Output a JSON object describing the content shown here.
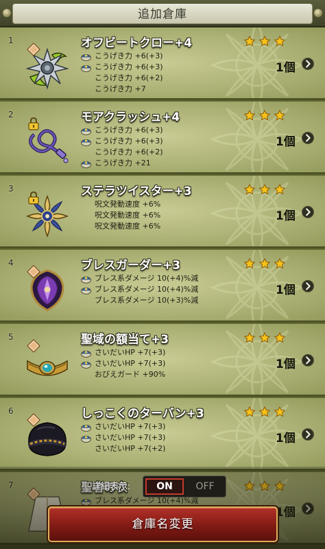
{
  "title": "追加倉庫",
  "items": [
    {
      "index": "1",
      "name": "オフビートクロー+4",
      "rarity_stars": 3,
      "quantity": "1個",
      "icon": "spiked-claw-icon",
      "locked": false,
      "stats": [
        {
          "text": "こうげき力 +6(+3)",
          "stat_icon": true
        },
        {
          "text": "こうげき力 +6(+3)",
          "stat_icon": true
        },
        {
          "text": "こうげき力 +6(+2)",
          "stat_icon": false
        },
        {
          "text": "こうげき力 +7",
          "stat_icon": false
        }
      ]
    },
    {
      "index": "2",
      "name": "モアクラッシュ+4",
      "rarity_stars": 3,
      "quantity": "1個",
      "icon": "whip-icon",
      "locked": true,
      "stats": [
        {
          "text": "こうげき力 +6(+3)",
          "stat_icon": true
        },
        {
          "text": "こうげき力 +6(+3)",
          "stat_icon": true
        },
        {
          "text": "こうげき力 +6(+2)",
          "stat_icon": false
        },
        {
          "text": "こうげき力 +21",
          "stat_icon": true
        }
      ]
    },
    {
      "index": "3",
      "name": "ステラツイスター+3",
      "rarity_stars": 3,
      "quantity": "1個",
      "icon": "star-boomerang-icon",
      "locked": true,
      "stats": [
        {
          "text": "呪文発動速度 +6%",
          "stat_icon": false
        },
        {
          "text": "呪文発動速度 +6%",
          "stat_icon": false
        },
        {
          "text": "呪文発動速度 +6%",
          "stat_icon": false
        }
      ]
    },
    {
      "index": "4",
      "name": "ブレスガーダー+3",
      "rarity_stars": 3,
      "quantity": "1個",
      "icon": "shield-icon",
      "locked": false,
      "stats": [
        {
          "text": "ブレス系ダメージ 10(+4)%減",
          "stat_icon": true
        },
        {
          "text": "ブレス系ダメージ 10(+4)%減",
          "stat_icon": true
        },
        {
          "text": "ブレス系ダメージ 10(+3)%減",
          "stat_icon": false
        }
      ]
    },
    {
      "index": "5",
      "name": "聖域の額当て+3",
      "rarity_stars": 3,
      "quantity": "1個",
      "icon": "circlet-icon",
      "locked": false,
      "stats": [
        {
          "text": "さいだいHP +7(+3)",
          "stat_icon": true
        },
        {
          "text": "さいだいHP +7(+3)",
          "stat_icon": true
        },
        {
          "text": "おびえガード +90%",
          "stat_icon": false
        }
      ]
    },
    {
      "index": "6",
      "name": "しっこくのターバン+3",
      "rarity_stars": 3,
      "quantity": "1個",
      "icon": "turban-icon",
      "locked": false,
      "stats": [
        {
          "text": "さいだいHP +7(+3)",
          "stat_icon": true
        },
        {
          "text": "さいだいHP +7(+3)",
          "stat_icon": true
        },
        {
          "text": "さいだいHP +7(+2)",
          "stat_icon": false
        }
      ]
    },
    {
      "index": "7",
      "name": "聖者の衣",
      "rarity_stars": 3,
      "quantity": "1個",
      "icon": "robe-icon",
      "locked": false,
      "stats": [
        {
          "text": "ブレス系ダメージ 10(+4)%減",
          "stat_icon": true
        }
      ]
    }
  ],
  "detail_toggle": {
    "label": "詳細表示:",
    "on_label": "ON",
    "off_label": "OFF",
    "value": "ON"
  },
  "rename_button": "倉庫名変更",
  "colors": {
    "accent_red": "#b23128",
    "gold_border": "#d9b15a",
    "star": "#f6c21a"
  }
}
